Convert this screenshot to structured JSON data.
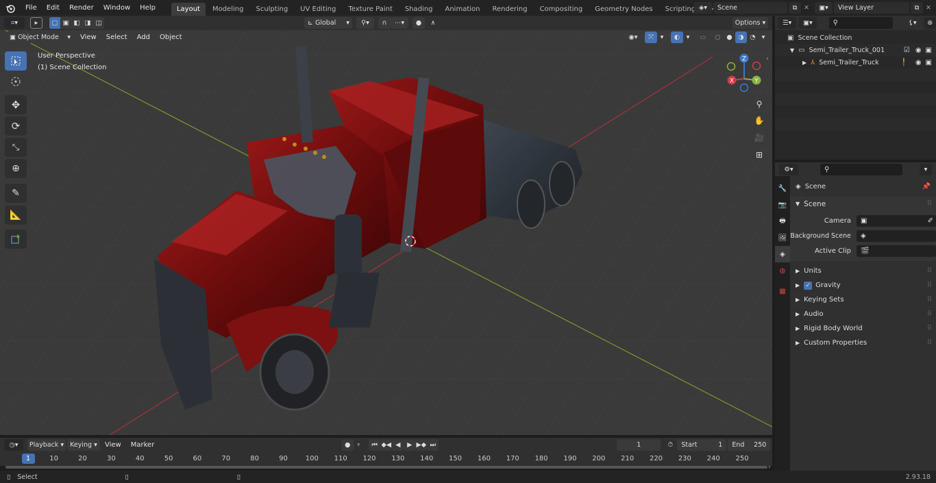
{
  "menu": [
    "File",
    "Edit",
    "Render",
    "Window",
    "Help"
  ],
  "workspaces": [
    "Layout",
    "Modeling",
    "Sculpting",
    "UV Editing",
    "Texture Paint",
    "Shading",
    "Animation",
    "Rendering",
    "Compositing",
    "Geometry Nodes",
    "Scripting"
  ],
  "active_workspace": "Layout",
  "scene_name": "Scene",
  "view_layer": "View Layer",
  "viewport": {
    "mode": "Object Mode",
    "menus": [
      "View",
      "Select",
      "Add",
      "Object"
    ],
    "transform_orientation": "Global",
    "options_label": "Options",
    "perspective_label": "User Perspective",
    "collection_label": "(1) Scene Collection",
    "gizmo_axes": {
      "z": "Z",
      "y": "Y",
      "x": "X"
    }
  },
  "outliner": {
    "search_placeholder": "",
    "root": "Scene Collection",
    "items": [
      {
        "name": "Semi_Trailer_Truck_001"
      },
      {
        "name": "Semi_Trailer_Truck"
      }
    ]
  },
  "properties": {
    "context": "Scene",
    "section": "Scene",
    "fields": [
      {
        "label": "Camera",
        "value": ""
      },
      {
        "label": "Background Scene",
        "value": ""
      },
      {
        "label": "Active Clip",
        "value": ""
      }
    ],
    "panels": [
      "Units",
      "Gravity",
      "Keying Sets",
      "Audio",
      "Rigid Body World",
      "Custom Properties"
    ],
    "gravity_checked": true
  },
  "timeline": {
    "menus": [
      "Playback",
      "Keying",
      "View",
      "Marker"
    ],
    "current_frame": "1",
    "start_label": "Start",
    "start": "1",
    "end_label": "End",
    "end": "250",
    "ticks": [
      "1",
      "10",
      "20",
      "30",
      "40",
      "50",
      "60",
      "70",
      "80",
      "90",
      "100",
      "110",
      "120",
      "130",
      "140",
      "150",
      "160",
      "170",
      "180",
      "190",
      "200",
      "210",
      "220",
      "230",
      "240",
      "250"
    ]
  },
  "status": {
    "left": "Select",
    "version": "2.93.18"
  },
  "colors": {
    "accent": "#4772b3",
    "x_axis": "#d03a4a",
    "y_axis": "#8ab33a",
    "z_axis": "#3a78d0",
    "truck_red": "#7a1010"
  }
}
